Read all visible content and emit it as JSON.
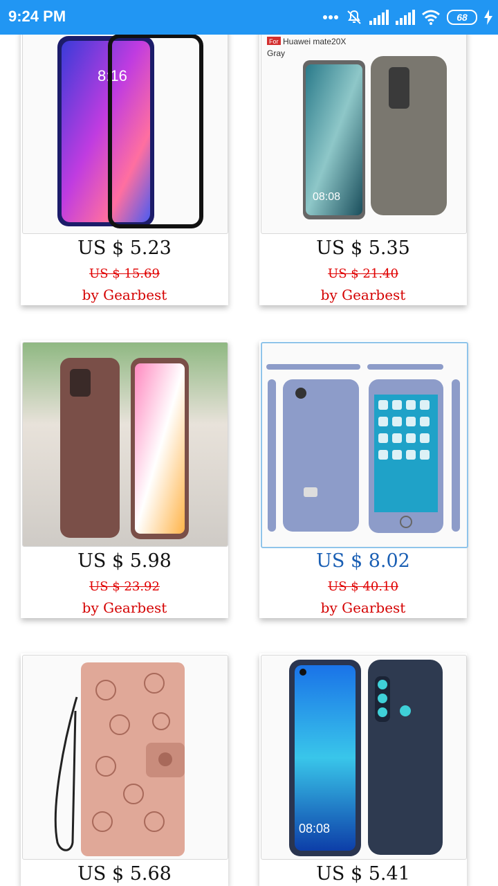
{
  "status_bar": {
    "time": "9:24 PM",
    "battery": "68",
    "icons": [
      "more-icon",
      "mute-icon",
      "signal-icon",
      "signal-icon",
      "wifi-icon",
      "battery-icon",
      "charging-icon"
    ]
  },
  "products": [
    {
      "price": "US $ 5.23",
      "original_price": "US $ 15.69",
      "seller": "by Gearbest",
      "image": "phone-screen-protector"
    },
    {
      "price": "US $ 5.35",
      "original_price": "US $ 21.40",
      "seller": "by Gearbest",
      "image": "gray-carbon-case",
      "image_label_brand": "Huawei mate20X",
      "image_label_color": "Gray",
      "image_tag": "For"
    },
    {
      "price": "US $ 5.98",
      "original_price": "US $ 23.92",
      "seller": "by Gearbest",
      "image": "rose-carbon-case"
    },
    {
      "price": "US $ 8.02",
      "original_price": "US $ 40.10",
      "seller": "by Gearbest",
      "image": "blue-kickstand-case"
    },
    {
      "price": "US $ 5.68",
      "original_price": "",
      "seller": "",
      "image": "rose-gold-wallet-case"
    },
    {
      "price": "US $ 5.41",
      "original_price": "",
      "seller": "",
      "image": "navy-carbon-case"
    }
  ],
  "colors": {
    "status_bar": "#2196f3",
    "price": "#111111",
    "selected_price": "#1a5fb4",
    "seller": "#d40000"
  }
}
